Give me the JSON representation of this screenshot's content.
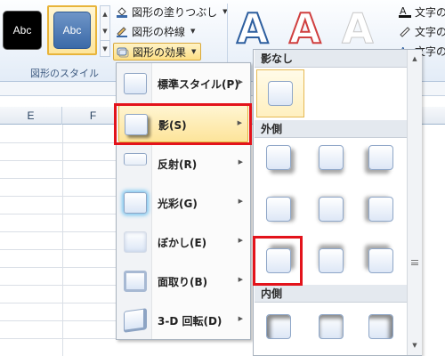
{
  "ribbon": {
    "shape_styles": {
      "swatch_black_label": "Abc",
      "swatch_blue_label": "Abc",
      "group_label": "図形のスタイル"
    },
    "commands": {
      "fill_label": "図形の塗りつぶし",
      "outline_label": "図形の枠線",
      "effects_label": "図形の効果"
    },
    "wordart": {
      "letter_1": "A",
      "letter_2": "A",
      "letter_3": "A"
    },
    "text_commands": {
      "text_fill_label": "文字の",
      "text_outline_label": "文字の",
      "text_effects_label": "文字の"
    }
  },
  "sheet": {
    "columns": [
      "E",
      "F"
    ]
  },
  "effects_menu": {
    "items": [
      {
        "label": "標準スタイル(P)",
        "icon": "preset-style-icon"
      },
      {
        "label": "影(S)",
        "icon": "shadow-icon"
      },
      {
        "label": "反射(R)",
        "icon": "reflection-icon"
      },
      {
        "label": "光彩(G)",
        "icon": "glow-icon"
      },
      {
        "label": "ぼかし(E)",
        "icon": "soft-edges-icon"
      },
      {
        "label": "面取り(B)",
        "icon": "bevel-icon"
      },
      {
        "label": "3-D 回転(D)",
        "icon": "3d-rotation-icon"
      }
    ],
    "highlighted_item": "影(S)"
  },
  "shadow_gallery": {
    "sections": [
      "影なし",
      "外側",
      "内側"
    ],
    "outer_presets_count": 9,
    "inner_presets_visible": 3,
    "selected_section": "影なし"
  },
  "colors": {
    "highlight_red": "#e3131b",
    "menu_hover": "#fde49a",
    "accent_blue": "#3b6aa8"
  }
}
